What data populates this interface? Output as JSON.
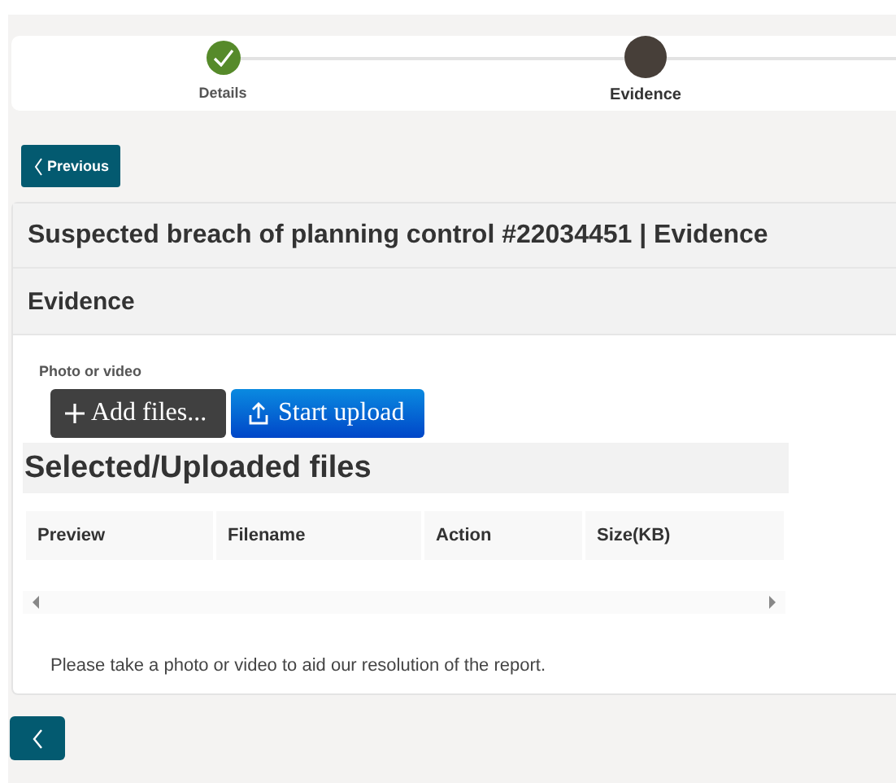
{
  "steps": [
    {
      "label": "Details",
      "completed": true,
      "selected": false
    },
    {
      "label": "Evidence",
      "completed": false,
      "selected": true
    }
  ],
  "previous_button": {
    "label": "Previous"
  },
  "report_title": "Suspected breach of planning control #22034451 | Evidence",
  "section_heading": "Evidence",
  "upload": {
    "label": "Photo or video",
    "add_button": "Add files...",
    "start_button": "Start upload",
    "files_heading": "Selected/Uploaded files",
    "table": {
      "columns": [
        "Preview",
        "Filename",
        "Action",
        "Size(KB)"
      ]
    },
    "hint": "Please take a photo or video to aid our resolution of the report."
  }
}
